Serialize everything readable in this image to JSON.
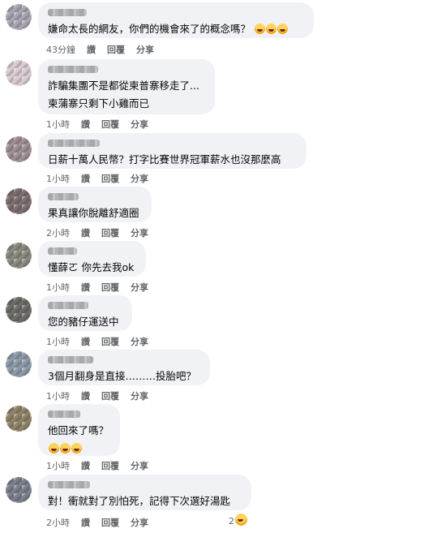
{
  "comments": [
    {
      "text1": "嫌命太長的網友，你們的機會來了的概念嗎？",
      "emoji_count": 3,
      "time": "43分鐘"
    },
    {
      "text1": "詐騙集團不是都從柬普寨移走了...",
      "text2": "柬蒲寨只剩下小雞而已",
      "time": "1小時"
    },
    {
      "text1": "日薪十萬人民幣？打字比賽世界冠軍薪水也沒那麼高",
      "time": "1小時"
    },
    {
      "text1": "果真讓你脫離舒適圈",
      "time": "2小時"
    },
    {
      "text1": "懂薛ㄛ 你先去我ok",
      "time": "1小時"
    },
    {
      "text1": "您的豬仔運送中",
      "time": "1小時"
    },
    {
      "text1": "3個月翻身是直接………投胎吧？",
      "time": "1小時"
    },
    {
      "text1": "他回來了嗎？",
      "emoji_count": 3,
      "time": "1小時"
    },
    {
      "text1": "對！衝就對了別怕死，記得下次選好湯匙",
      "time": "2小時",
      "reaction_count": "2"
    }
  ],
  "actions": {
    "like": "讚",
    "reply": "回覆",
    "share": "分享"
  },
  "colors": {
    "bubble": "#f0f2f5",
    "meta": "#65676b",
    "text": "#050505"
  }
}
